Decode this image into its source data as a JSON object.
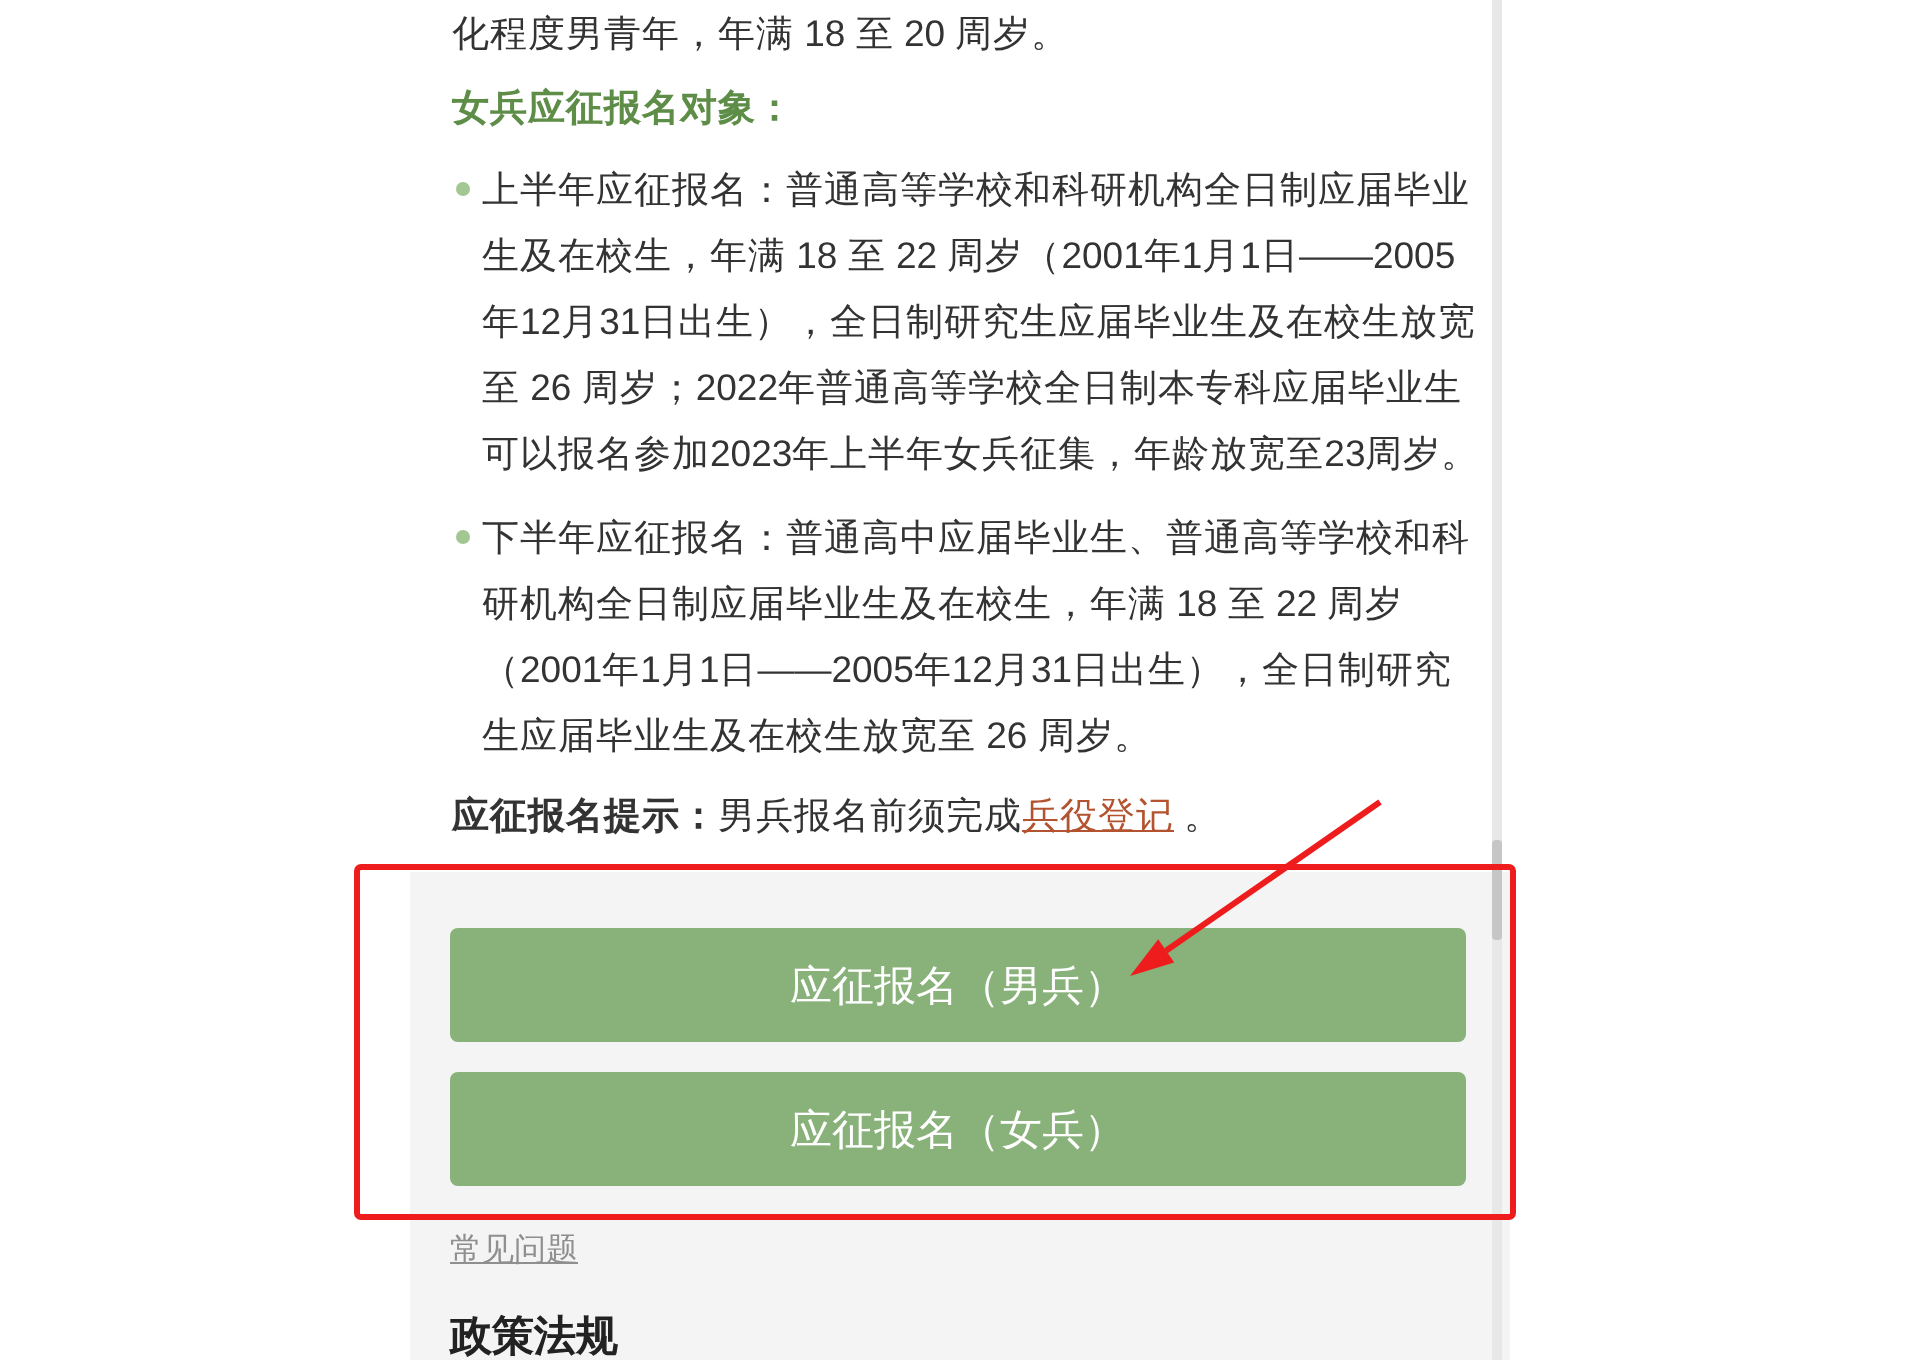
{
  "article": {
    "intro_tail": "化程度男青年，年满 18 至 20 周岁。",
    "section_heading": "女兵应征报名对象：",
    "bullets": [
      {
        "text": "上半年应征报名：普通高等学校和科研机构全日制应届毕业生及在校生，年满 18 至 22 周岁（2001年1月1日——2005年12月31日出生），全日制研究生应届毕业生及在校生放宽至 26 周岁；2022年普通高等学校全日制本专科应届毕业生可以报名参加2023年上半年女兵征集，年龄放宽至23周岁。"
      },
      {
        "text": "下半年应征报名：普通高中应届毕业生、普通高等学校和科研机构全日制应届毕业生及在校生，年满 18 至 22 周岁（2001年1月1日——2005年12月31日出生），全日制研究生应届毕业生及在校生放宽至 26 周岁。"
      }
    ],
    "tip": {
      "text": "**应征报名提示：**男兵报名前须完成",
      "link": "兵役登记",
      "after": " 。"
    }
  },
  "actions": {
    "buttons": [
      "应征报名（男兵）",
      "应征报名（女兵）"
    ],
    "faq_link": "常见问题"
  },
  "next_section_title": "政策法规"
}
